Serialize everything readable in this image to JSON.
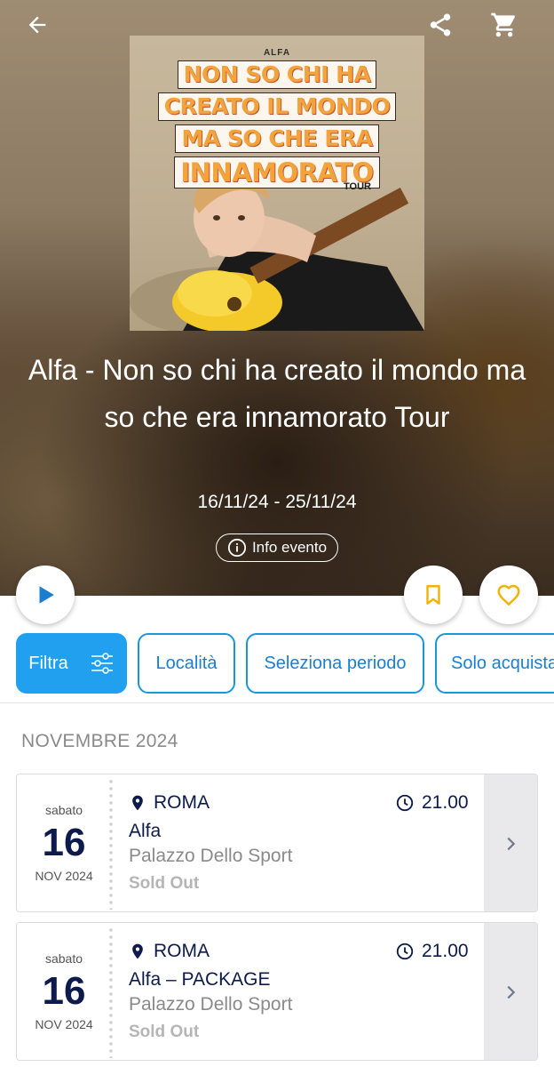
{
  "header": {
    "icons": [
      "back-arrow-icon",
      "share-icon",
      "cart-icon"
    ]
  },
  "poster": {
    "artist": "ALFA",
    "title_lines": [
      "NON SO CHI HA",
      "CREATO IL MONDO",
      "MA SO CHE ERA",
      "INNAMORATO"
    ],
    "tour": "TOUR"
  },
  "event": {
    "title": "Alfa - Non so chi ha creato il mondo ma so che era innamorato Tour",
    "dates": "16/11/24 - 25/11/24",
    "info_label": "Info evento"
  },
  "colors": {
    "accent": "#20a0ef",
    "chip_border": "#1a97d9",
    "heart": "#f0b400",
    "navy": "#0d1b4c"
  },
  "filters": {
    "filtra": "Filtra",
    "localita": "Località",
    "periodo": "Seleziona periodo",
    "solo": "Solo acquistabili"
  },
  "section": {
    "month": "NOVEMBRE 2024"
  },
  "events": [
    {
      "weekday": "sabato",
      "day": "16",
      "month_year": "NOV 2024",
      "city": "ROMA",
      "time": "21.00",
      "name": "Alfa",
      "venue": "Palazzo Dello Sport",
      "status": "Sold Out"
    },
    {
      "weekday": "sabato",
      "day": "16",
      "month_year": "NOV 2024",
      "city": "ROMA",
      "time": "21.00",
      "name": "Alfa – PACKAGE",
      "venue": "Palazzo Dello Sport",
      "status": "Sold Out"
    }
  ]
}
